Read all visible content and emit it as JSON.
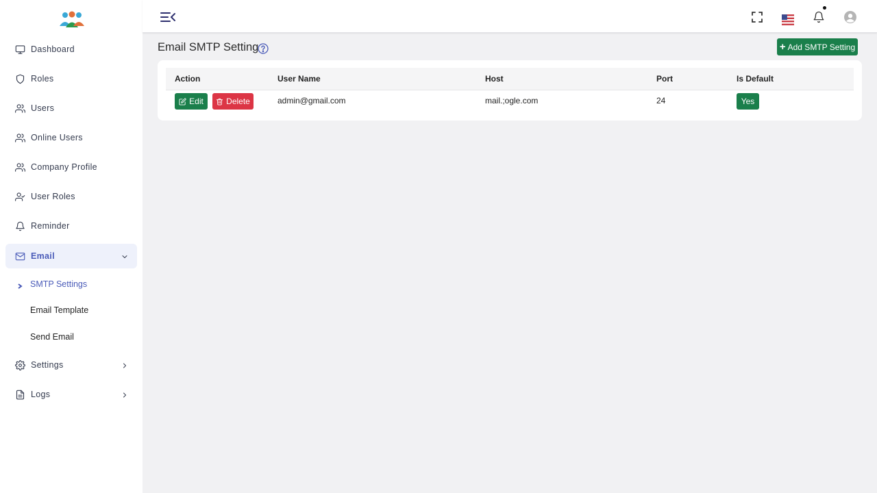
{
  "sidebar": {
    "items": [
      {
        "label": "Dashboard",
        "icon": "monitor-icon"
      },
      {
        "label": "Roles",
        "icon": "shield-icon"
      },
      {
        "label": "Users",
        "icon": "users-icon"
      },
      {
        "label": "Online Users",
        "icon": "users-icon"
      },
      {
        "label": "Company Profile",
        "icon": "users-icon"
      },
      {
        "label": "User Roles",
        "icon": "user-check-icon"
      },
      {
        "label": "Reminder",
        "icon": "bell-icon"
      },
      {
        "label": "Email",
        "icon": "mail-icon"
      },
      {
        "label": "Settings",
        "icon": "gear-icon"
      },
      {
        "label": "Logs",
        "icon": "file-icon"
      }
    ],
    "email_submenu": [
      "SMTP Settings",
      "Email Template",
      "Send Email"
    ]
  },
  "header": {
    "notification_dot": true
  },
  "main": {
    "title": "Email SMTP Setting",
    "add_button_label": "Add SMTP Setting",
    "table": {
      "headers": [
        "Action",
        "User Name",
        "Host",
        "Port",
        "Is Default"
      ],
      "rows": [
        {
          "edit_label": "Edit",
          "delete_label": "Delete",
          "user_name": "admin@gmail.com",
          "host": "mail.;ogle.com",
          "port": "24",
          "is_default": "Yes"
        }
      ]
    }
  },
  "colors": {
    "accent": "#4a5bb8",
    "success": "#1a7f4b",
    "danger": "#dc3545",
    "navy": "#2d2f6e"
  }
}
